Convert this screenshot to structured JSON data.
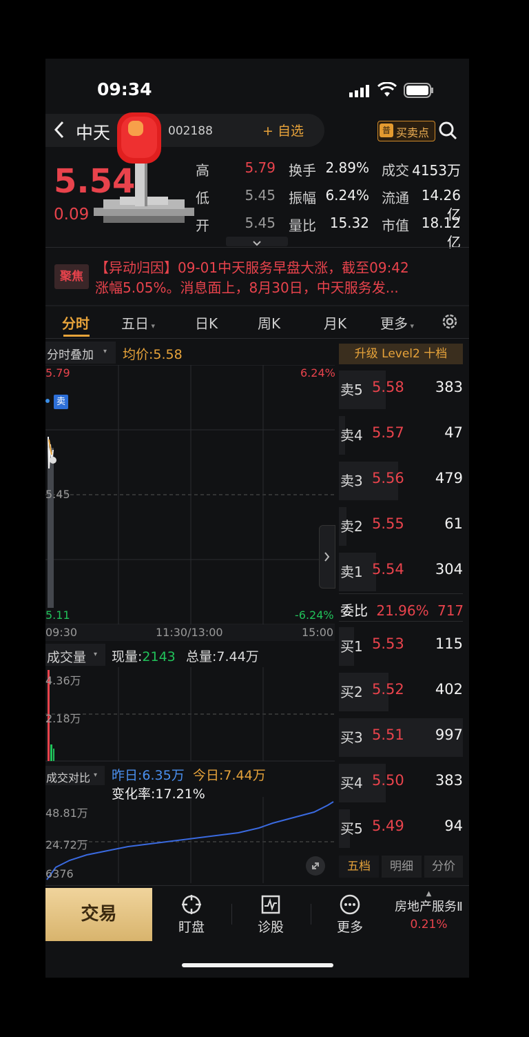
{
  "status": {
    "time": "09:34"
  },
  "header": {
    "back_icon": "chevron-left-icon",
    "name": "中天",
    "code": "002188",
    "add_fav": "+ 自选",
    "buysell_badge": "普",
    "buysell_label": "买卖点"
  },
  "quote": {
    "price": "5.54",
    "change": "0.09",
    "stats": [
      {
        "l1": "高",
        "v1": "5.79",
        "l2": "换手",
        "v2": "2.89%",
        "l3": "成交",
        "v3": "4153万"
      },
      {
        "l1": "低",
        "v1": "5.45",
        "l2": "振幅",
        "v2": "6.24%",
        "l3": "流通",
        "v3": "14.26亿"
      },
      {
        "l1": "开",
        "v1": "5.45",
        "l2": "量比",
        "v2": "15.32",
        "l3": "市值",
        "v3": "18.12亿"
      }
    ]
  },
  "news": {
    "icon_label": "聚焦",
    "line1": "【异动归因】09-01中天服务早盘大涨，截至09:42",
    "line2": "涨幅5.05%。消息面上，8月30日，中天服务发..."
  },
  "tabs": [
    "分时",
    "五日",
    "日K",
    "周K",
    "月K",
    "更多"
  ],
  "chart": {
    "overlay_label": "分时叠加",
    "avg_label": "均价:",
    "avg_value": "5.58",
    "high": "5.79",
    "mid": "5.45",
    "low": "5.11",
    "pct_high": "6.24%",
    "pct_low": "-6.24%",
    "sell_tag": "卖",
    "times": [
      "09:30",
      "11:30/13:00",
      "15:00"
    ]
  },
  "volume": {
    "label": "成交量",
    "cur_label": "现量:",
    "cur_value": "2143",
    "tot_label": "总量:",
    "tot_value": "7.44万",
    "ticks": [
      "4.36万",
      "2.18万"
    ]
  },
  "compare": {
    "label": "成交对比",
    "yday": "昨日:6.35万",
    "today": "今日:7.44万",
    "rate": "变化率:17.21%",
    "ticks": [
      "48.81万",
      "24.72万",
      "6376"
    ]
  },
  "orderbook": {
    "upgrade": "升级 Level2 十档",
    "asks": [
      {
        "label": "卖5",
        "price": "5.58",
        "vol": "383",
        "depth": 0.38
      },
      {
        "label": "卖4",
        "price": "5.57",
        "vol": "47",
        "depth": 0.05
      },
      {
        "label": "卖3",
        "price": "5.56",
        "vol": "479",
        "depth": 0.48
      },
      {
        "label": "卖2",
        "price": "5.55",
        "vol": "61",
        "depth": 0.06
      },
      {
        "label": "卖1",
        "price": "5.54",
        "vol": "304",
        "depth": 0.3
      }
    ],
    "ratio_label": "委比",
    "ratio_pct": "21.96%",
    "ratio_val": "717",
    "bids": [
      {
        "label": "买1",
        "price": "5.53",
        "vol": "115",
        "depth": 0.12
      },
      {
        "label": "买2",
        "price": "5.52",
        "vol": "402",
        "depth": 0.4
      },
      {
        "label": "买3",
        "price": "5.51",
        "vol": "997",
        "depth": 1.0
      },
      {
        "label": "买4",
        "price": "5.50",
        "vol": "383",
        "depth": 0.38
      },
      {
        "label": "买5",
        "price": "5.49",
        "vol": "94",
        "depth": 0.09
      }
    ],
    "footer_tabs": [
      "五档",
      "明细",
      "分价"
    ]
  },
  "bottom": {
    "trade": "交易",
    "items": [
      "盯盘",
      "诊股",
      "更多"
    ],
    "sector": "房地产服务Ⅱ",
    "sector_pct": "0.21%"
  }
}
